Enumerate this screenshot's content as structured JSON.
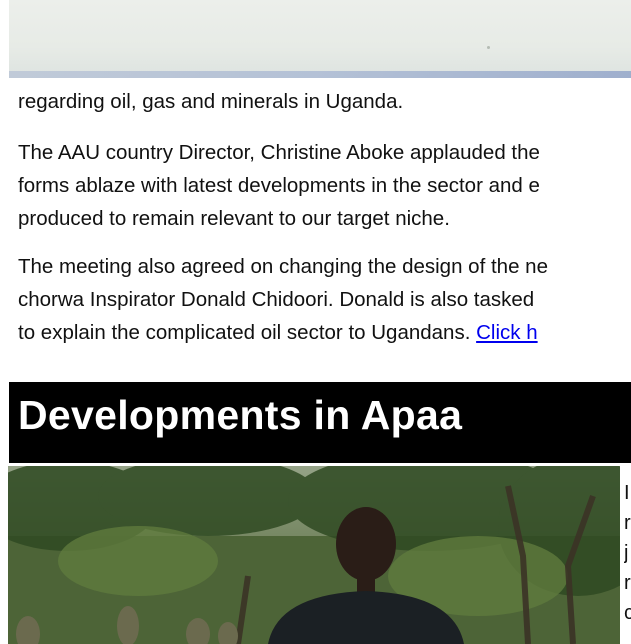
{
  "paragraphs": [
    [
      "regarding oil, gas and minerals in Uganda."
    ],
    [
      "The AAU  country Director, Christine Aboke applauded the",
      "forms ablaze with latest developments in the sector  and e",
      "produced to remain relevant to our target niche."
    ],
    [
      "The meeting also agreed on changing the design of the ne",
      "chorwa Inspirator Donald Chidoori.  Donald is also tasked",
      "to  explain the complicated oil sector to Ugandans. "
    ]
  ],
  "link_text": "Click h",
  "section_title": "Developments in Apaa",
  "side_text": [
    "I",
    "r",
    "j",
    "r",
    "c"
  ],
  "colors": {
    "banner": "#000000",
    "link": "#0000ee"
  }
}
